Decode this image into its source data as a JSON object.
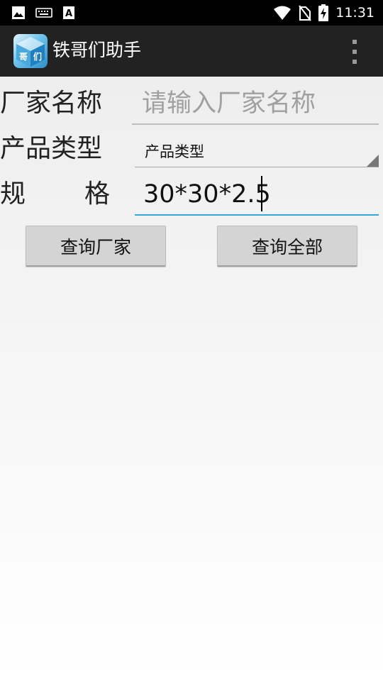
{
  "status_bar": {
    "time": "11:31",
    "icons": [
      "image-icon",
      "keyboard-icon",
      "text-a-icon",
      "wifi-icon",
      "no-sim-icon",
      "battery-charging-icon"
    ]
  },
  "action_bar": {
    "title": "铁哥们助手",
    "app_icon_text": "哥们",
    "overflow_icon": "overflow-menu-icon"
  },
  "form": {
    "manufacturer_label": "厂家名称",
    "manufacturer_placeholder": "请输入厂家名称",
    "manufacturer_value": "",
    "product_type_label": "产品类型",
    "product_type_selected": "产品类型",
    "spec_label_char1": "规",
    "spec_label_char2": "格",
    "spec_value": "30*30*2.5"
  },
  "buttons": {
    "query_manufacturer": "查询厂家",
    "query_all": "查询全部"
  },
  "colors": {
    "status_bar": "#000000",
    "action_bar": "#222222",
    "focus_underline": "#33a8d6",
    "button_bg": "#d4d4d4"
  }
}
